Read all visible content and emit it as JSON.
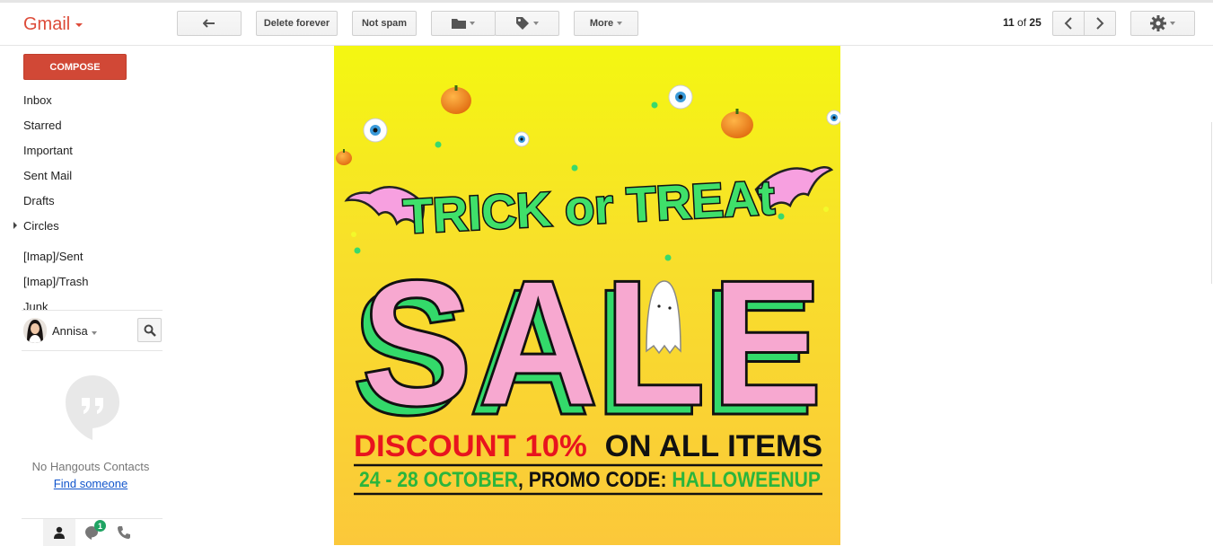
{
  "header": {
    "app_title": "Gmail",
    "actions": {
      "delete_forever": "Delete forever",
      "not_spam": "Not spam",
      "more": "More"
    },
    "pager": {
      "current": "11",
      "of_label": "of",
      "total": "25"
    }
  },
  "sidebar": {
    "compose_label": "COMPOSE",
    "items": [
      {
        "label": "Inbox"
      },
      {
        "label": "Starred"
      },
      {
        "label": "Important"
      },
      {
        "label": "Sent Mail"
      },
      {
        "label": "Drafts"
      },
      {
        "label": "Circles"
      },
      {
        "label": "[Imap]/Sent"
      },
      {
        "label": "[Imap]/Trash"
      },
      {
        "label": "Junk"
      }
    ],
    "user_name": "Annisa",
    "hangouts": {
      "empty_text": "No Hangouts Contacts",
      "find_link": "Find someone",
      "badge_count": "1"
    }
  },
  "email_banner": {
    "headline_1": "TRICK or TREAt",
    "headline_2": "SALE",
    "discount_red": "DISCOUNT 10%",
    "discount_black": "ON ALL ITEMS",
    "dates": "24 - 28 OCTOBER",
    "promo_prefix": ", PROMO CODE: ",
    "promo_code": "HALLOWEENUP"
  },
  "colors": {
    "brand_red": "#dd4b39",
    "compose_red": "#d14836",
    "banner_yellow": "#f4f711",
    "sale_pink": "#f7a8d0",
    "sale_green": "#33d96a",
    "discount_red": "#e8141e",
    "promo_green": "#2bb53c"
  },
  "icons": [
    "back-arrow-icon",
    "folder-icon",
    "label-icon",
    "chevron-left-icon",
    "chevron-right-icon",
    "gear-icon",
    "search-icon",
    "hangouts-icon",
    "person-icon",
    "chat-icon",
    "phone-icon"
  ]
}
